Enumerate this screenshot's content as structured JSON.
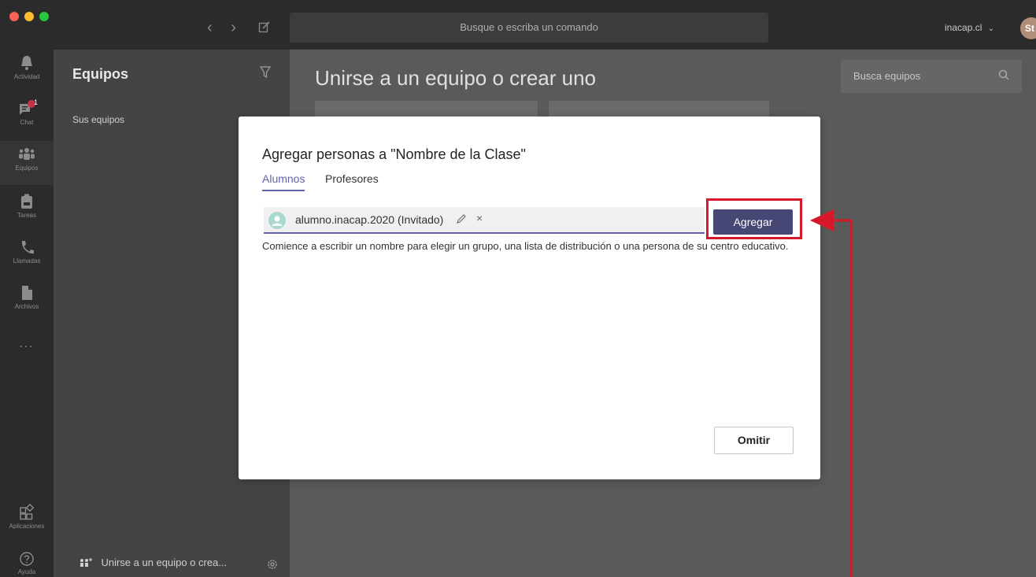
{
  "titlebar": {
    "back_glyph": "‹",
    "forward_glyph": "›",
    "search_placeholder": "Busque o escriba un comando",
    "tenant": "inacap.cl",
    "avatar_initials": "St"
  },
  "rail": {
    "items": [
      {
        "label": "Actividad",
        "icon": "bell-icon"
      },
      {
        "label": "Chat",
        "icon": "chat-icon",
        "badge": "1"
      },
      {
        "label": "Equipos",
        "icon": "teams-icon",
        "active": true
      },
      {
        "label": "Tareas",
        "icon": "assignments-icon"
      },
      {
        "label": "Llamadas",
        "icon": "phone-icon"
      },
      {
        "label": "Archivos",
        "icon": "files-icon"
      },
      {
        "label": "...",
        "icon": "more-icon"
      }
    ],
    "bottom": [
      {
        "label": "Aplicaciones",
        "icon": "apps-icon"
      },
      {
        "label": "Ayuda",
        "icon": "help-icon"
      }
    ]
  },
  "teams_panel": {
    "title": "Equipos",
    "section": "Sus equipos",
    "join_label": "Unirse a un equipo o crea..."
  },
  "main": {
    "title": "Unirse a un equipo o crear uno",
    "search_placeholder": "Busca equipos"
  },
  "dialog": {
    "title": "Agregar personas a \"Nombre de la Clase\"",
    "tabs": [
      "Alumnos",
      "Profesores"
    ],
    "active_tab": "Alumnos",
    "chip_label": "alumno.inacap.2020 (Invitado)",
    "chip_remove": "×",
    "add_button": "Agregar",
    "help_text": "Comience a escribir un nombre para elegir un grupo, una lista de distribución o una persona de su centro educativo.",
    "skip_button": "Omitir"
  },
  "annotation": {
    "color": "#d7182a"
  }
}
